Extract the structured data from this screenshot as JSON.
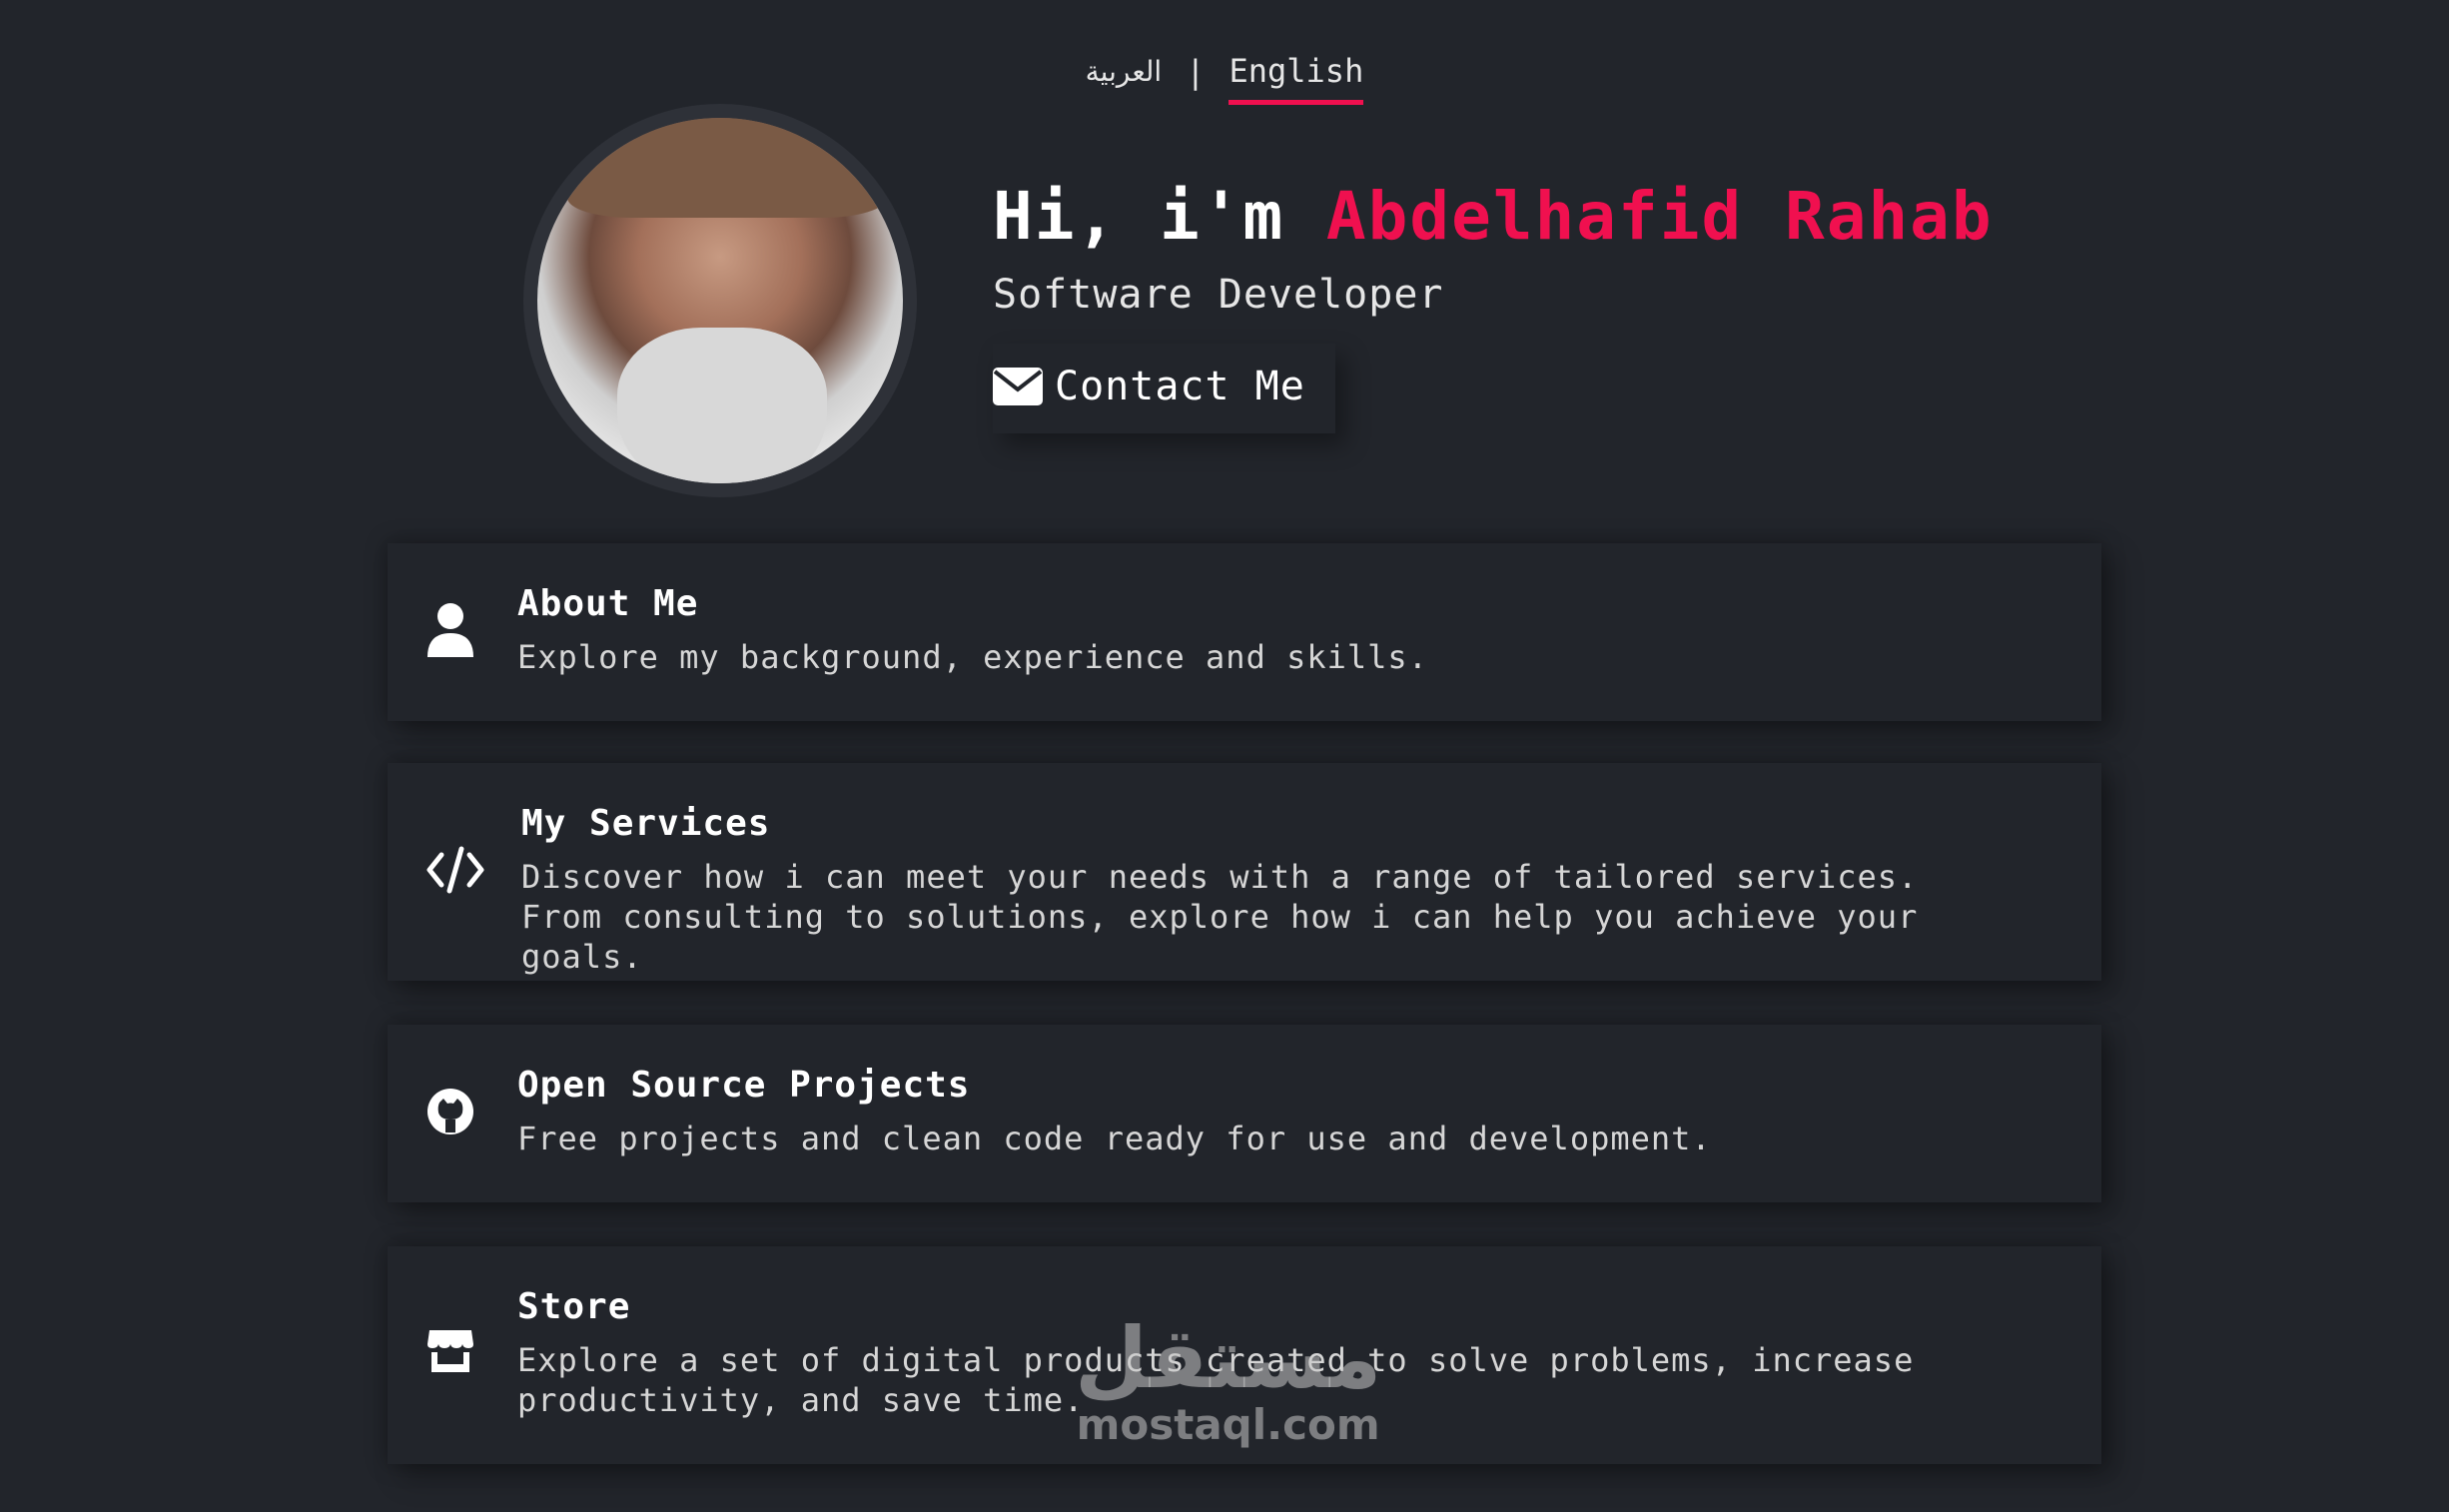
{
  "lang": {
    "arabic": "العربية",
    "separator": "|",
    "english": "English"
  },
  "hero": {
    "greeting": "Hi, i'm ",
    "name": "Abdelhafid Rahab",
    "role": "Software Developer",
    "contact_label": "Contact Me"
  },
  "cards": [
    {
      "title": "About Me",
      "desc": "Explore my background, experience and skills.",
      "icon": "user-icon"
    },
    {
      "title": "My Services",
      "desc": "Discover how i can meet your needs with a range of tailored services. From consulting to solutions, explore how i can help you achieve your goals.",
      "icon": "code-icon"
    },
    {
      "title": "Open Source Projects",
      "desc": "Free projects and clean code ready for use and development.",
      "icon": "github-icon"
    },
    {
      "title": "Store",
      "desc": "Explore a set of digital products created to solve problems, increase productivity, and save time.",
      "icon": "store-icon"
    }
  ],
  "watermark": {
    "arabic": "مستقل",
    "latin": "mostaql.com"
  },
  "colors": {
    "background": "#22252b",
    "accent": "#f0104f"
  }
}
